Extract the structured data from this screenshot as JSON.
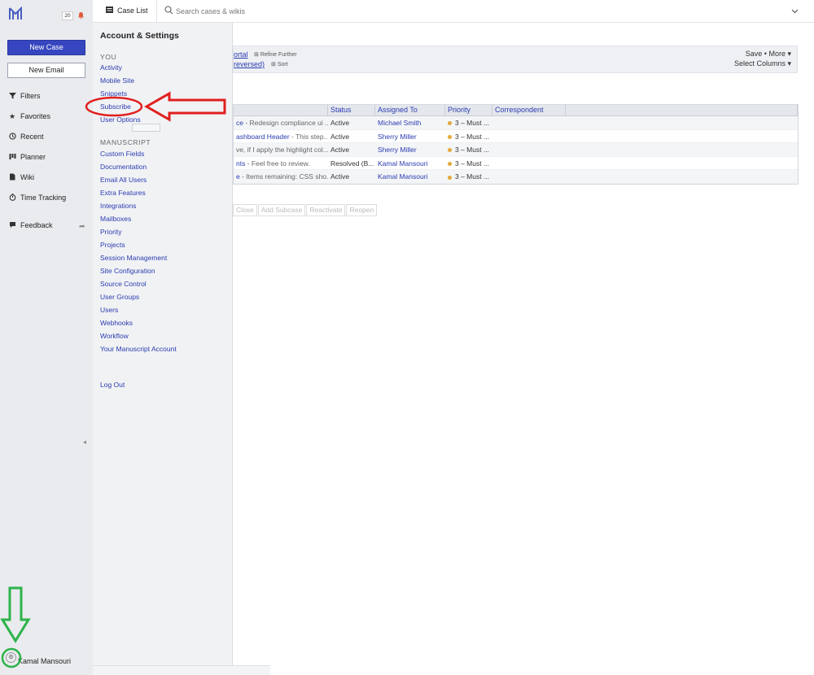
{
  "leftnav": {
    "notification_count": "20",
    "new_case_label": "New Case",
    "new_email_label": "New Email",
    "items": [
      {
        "label": "Filters",
        "icon": "filter-icon"
      },
      {
        "label": "Favorites",
        "icon": "star-icon"
      },
      {
        "label": "Recent",
        "icon": "history-icon"
      },
      {
        "label": "Planner",
        "icon": "planner-icon"
      },
      {
        "label": "Wiki",
        "icon": "wiki-icon"
      },
      {
        "label": "Time Tracking",
        "icon": "stopwatch-icon"
      },
      {
        "label": "Feedback",
        "icon": "speech-bubble-icon"
      }
    ],
    "user_name": "Kamal Mansouri"
  },
  "topbar": {
    "tab_label": "Case List",
    "search_placeholder": "Search cases & wikis"
  },
  "filterbar": {
    "filter_link_1": "ortal",
    "refine_label": "Refine Further",
    "filter_link_2": "reversed)",
    "sort_label": "Sort",
    "save_more": "Save • More",
    "select_columns": "Select Columns"
  },
  "table": {
    "columns": [
      "",
      "Status",
      "Assigned To",
      "Priority",
      "Correspondent",
      ""
    ],
    "rows": [
      {
        "title_link": "ce",
        "title_rest": " - Redesign compliance ui ...",
        "status": "Active",
        "assigned": "Michael Smith",
        "priority": "3 – Must ..."
      },
      {
        "title_link": "ashboard Header",
        "title_rest": " - This step...",
        "status": "Active",
        "assigned": "Sherry Miller",
        "priority": "3 – Must ..."
      },
      {
        "title_link": "",
        "title_rest": "ve, if I apply the highlight col...",
        "status": "Active",
        "assigned": "Sherry Miller",
        "priority": "3 – Must ..."
      },
      {
        "title_link": "nts",
        "title_rest": " - Feel free to review.",
        "status": "Resolved (B...",
        "assigned": "Kamal Mansouri",
        "priority": "3 – Must ..."
      },
      {
        "title_link": "e",
        "title_rest": " - Items remaining: CSS sho...",
        "status": "Active",
        "assigned": "Kamal Mansouri",
        "priority": "3 – Must ..."
      }
    ]
  },
  "actions": [
    "Close",
    "Add Subcase",
    "Reactivate",
    "Reopen"
  ],
  "panel": {
    "title": "Account & Settings",
    "section_you": "YOU",
    "you_items": [
      "Activity",
      "Mobile Site",
      "Snippets",
      "Subscribe",
      "User Options"
    ],
    "section_manuscript": "MANUSCRIPT",
    "manuscript_items": [
      "Custom Fields",
      "Documentation",
      "Email All Users",
      "Extra Features",
      "Integrations",
      "Mailboxes",
      "Priority",
      "Projects",
      "Session Management",
      "Site Configuration",
      "Source Control",
      "User Groups",
      "Users",
      "Webhooks",
      "Workflow",
      "Your Manuscript Account"
    ],
    "logout": "Log Out"
  },
  "colors": {
    "brand_blue": "#3646c0",
    "link_blue": "#2a3cb0",
    "annotation_red": "#e0201e",
    "annotation_green": "#2db34a",
    "priority_dot": "#e3a93a"
  }
}
